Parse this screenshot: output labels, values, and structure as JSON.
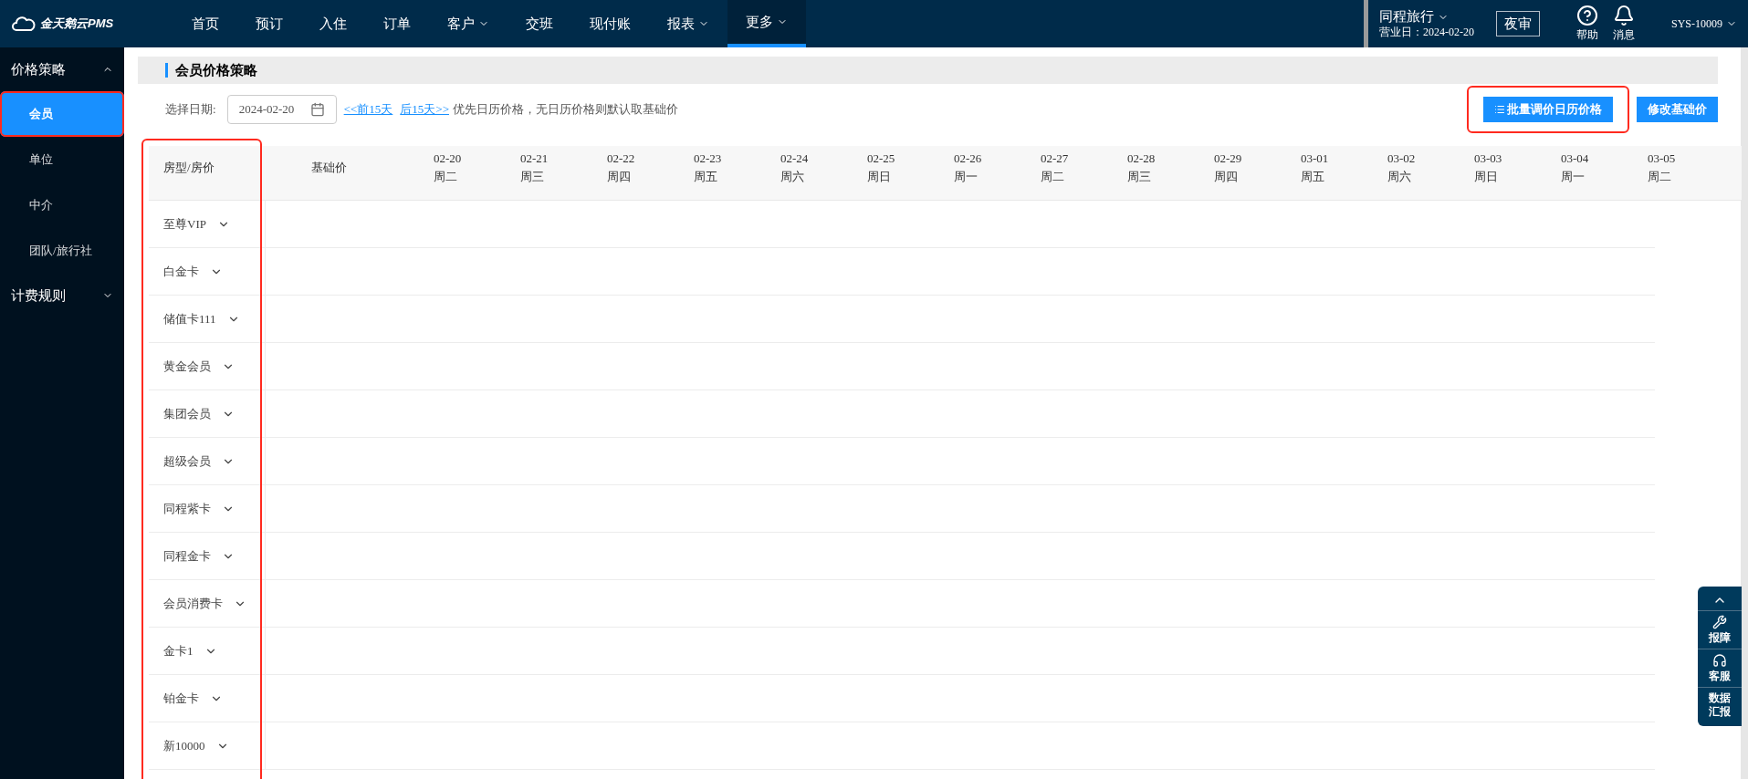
{
  "logo": {
    "text": "金天鹅云PMS"
  },
  "nav": [
    {
      "label": "首页",
      "dropdown": false,
      "selected": false
    },
    {
      "label": "预订",
      "dropdown": false,
      "selected": false
    },
    {
      "label": "入住",
      "dropdown": false,
      "selected": false
    },
    {
      "label": "订单",
      "dropdown": false,
      "selected": false
    },
    {
      "label": "客户",
      "dropdown": true,
      "selected": false
    },
    {
      "label": "交班",
      "dropdown": false,
      "selected": false
    },
    {
      "label": "现付账",
      "dropdown": false,
      "selected": false
    },
    {
      "label": "报表",
      "dropdown": true,
      "selected": false
    },
    {
      "label": "更多",
      "dropdown": true,
      "selected": true
    }
  ],
  "hotel": {
    "name": "同程旅行",
    "business_date": "营业日：2024-02-20"
  },
  "night_audit": "夜审",
  "help": "帮助",
  "messages": "消息",
  "user": "SYS-10009",
  "sidebar": [
    {
      "label": "价格策略",
      "expanded": true,
      "children": [
        {
          "label": "会员",
          "selected": true,
          "highlighted": true
        },
        {
          "label": "单位",
          "selected": false,
          "highlighted": false
        },
        {
          "label": "中介",
          "selected": false,
          "highlighted": false
        },
        {
          "label": "团队/旅行社",
          "selected": false,
          "highlighted": false
        }
      ]
    },
    {
      "label": "计费规则",
      "expanded": false
    }
  ],
  "page_title": "会员价格策略",
  "date_filter": {
    "label": "选择日期:",
    "value": "2024-02-20",
    "prev": "<<前15天",
    "next": "后15天>>",
    "hint": "优先日历价格，无日历价格则默认取基础价"
  },
  "buttons": [
    {
      "label": "批量调价日历价格",
      "highlighted": true,
      "icon": true
    },
    {
      "label": "修改基础价",
      "highlighted": false,
      "icon": false
    }
  ],
  "table": {
    "first_column": "房型/房价",
    "first_column_highlighted": true,
    "base_column": "基础价",
    "dates": [
      {
        "date": "02-20",
        "weekday": "周二"
      },
      {
        "date": "02-21",
        "weekday": "周三"
      },
      {
        "date": "02-22",
        "weekday": "周四"
      },
      {
        "date": "02-23",
        "weekday": "周五"
      },
      {
        "date": "02-24",
        "weekday": "周六"
      },
      {
        "date": "02-25",
        "weekday": "周日"
      },
      {
        "date": "02-26",
        "weekday": "周一"
      },
      {
        "date": "02-27",
        "weekday": "周二"
      },
      {
        "date": "02-28",
        "weekday": "周三"
      },
      {
        "date": "02-29",
        "weekday": "周四"
      },
      {
        "date": "03-01",
        "weekday": "周五"
      },
      {
        "date": "03-02",
        "weekday": "周六"
      },
      {
        "date": "03-03",
        "weekday": "周日"
      },
      {
        "date": "03-04",
        "weekday": "周一"
      },
      {
        "date": "03-05",
        "weekday": "周二"
      }
    ],
    "rows": [
      {
        "name": "至尊VIP",
        "expanded": false
      },
      {
        "name": "白金卡",
        "expanded": false
      },
      {
        "name": "储值卡111",
        "expanded": false
      },
      {
        "name": "黄金会员",
        "expanded": false
      },
      {
        "name": "集团会员",
        "expanded": false
      },
      {
        "name": "超级会员",
        "expanded": false
      },
      {
        "name": "同程紫卡",
        "expanded": false
      },
      {
        "name": "同程金卡",
        "expanded": false
      },
      {
        "name": "会员消费卡",
        "expanded": false
      },
      {
        "name": "金卡1",
        "expanded": false
      },
      {
        "name": "铂金卡",
        "expanded": false
      },
      {
        "name": "新10000",
        "expanded": false
      }
    ]
  },
  "float_panel": [
    {
      "label": "报障",
      "kind": "wrench"
    },
    {
      "label": "客服",
      "kind": "headset"
    },
    {
      "label": "数据汇报",
      "kind": "text"
    }
  ]
}
